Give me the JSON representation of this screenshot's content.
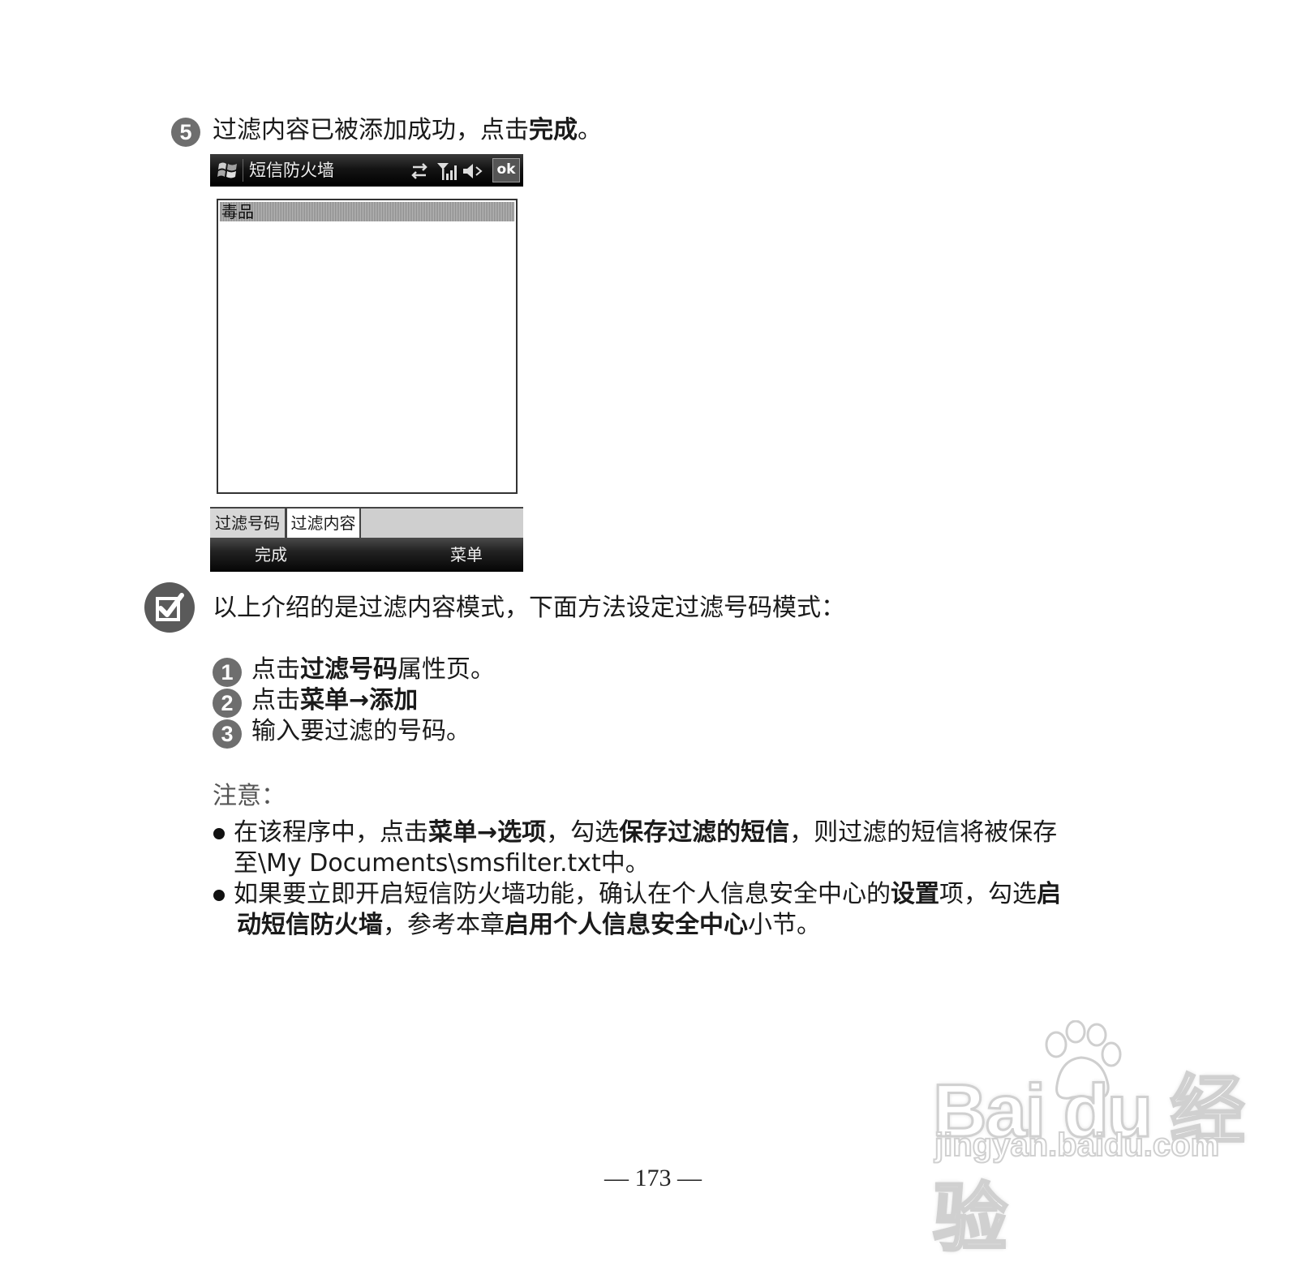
{
  "step5": {
    "number": "5",
    "text_before": "过滤内容已被添加成功，点击",
    "text_bold": "完成",
    "text_after": "。"
  },
  "phone": {
    "app_title": "短信防火墙",
    "ok_label": "ok",
    "list_items": [
      "毒品"
    ],
    "tabs": [
      "过滤号码",
      "过滤内容"
    ],
    "softkey_left": "完成",
    "softkey_right": "菜单"
  },
  "tip": {
    "intro": "以上介绍的是过滤内容模式，下面方法设定过滤号码模式：",
    "steps": [
      {
        "number": "1",
        "pre": "点击",
        "bold": "过滤号码",
        "post": "属性页。"
      },
      {
        "number": "2",
        "pre": "点击",
        "bold": "菜单",
        "arrow": "→",
        "bold2": "添加",
        "post": ""
      },
      {
        "number": "3",
        "pre": "输入要过滤的号码。",
        "bold": "",
        "post": ""
      }
    ]
  },
  "notes": {
    "heading": "注意：",
    "note1": {
      "p1": "在该程序中，点击",
      "b1": "菜单",
      "arrow": "→",
      "b2": "选项",
      "p2": "，勾选",
      "b3": "保存过滤的短信",
      "p3": "，则过滤的短信将被保存",
      "line2": "至\\My Documents\\smsfilter.txt中。"
    },
    "note2": {
      "p1": "如果要立即开启短信防火墙功能，确认在个人信息安全中心的",
      "b1": "设置",
      "p2": "项，勾选",
      "b2": "启",
      "b3": "动短信防火墙",
      "p3": "，参考本章",
      "b4": "启用个人信息安全中心",
      "p4": "小节。"
    }
  },
  "watermark": {
    "logo": "Bai du 经验",
    "url": "jingyan.baidu.com"
  },
  "page_number": "— 173 —"
}
